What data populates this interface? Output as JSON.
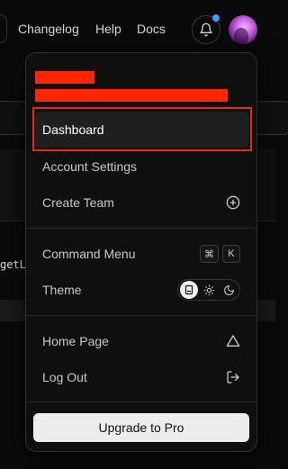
{
  "nav": {
    "links": [
      "Changelog",
      "Help",
      "Docs"
    ],
    "notification_dot_color": "#3b9eff"
  },
  "background": {
    "code_fragment": "getL"
  },
  "menu": {
    "items": [
      {
        "label": "Dashboard",
        "icon": null,
        "active": true
      },
      {
        "label": "Account Settings",
        "icon": null
      },
      {
        "label": "Create Team",
        "icon": "plus-circle-icon"
      },
      {
        "label": "Command Menu",
        "shortcut": [
          "⌘",
          "K"
        ]
      },
      {
        "label": "Theme",
        "theme_options": [
          "system-icon",
          "sun-icon",
          "moon-icon"
        ],
        "selected_theme": "system-icon"
      },
      {
        "label": "Home Page",
        "icon": "triangle-icon"
      },
      {
        "label": "Log Out",
        "icon": "logout-icon"
      }
    ],
    "upgrade_label": "Upgrade to Pro",
    "highlight_color": "#e8281b",
    "redaction_color": "#ff2600"
  }
}
